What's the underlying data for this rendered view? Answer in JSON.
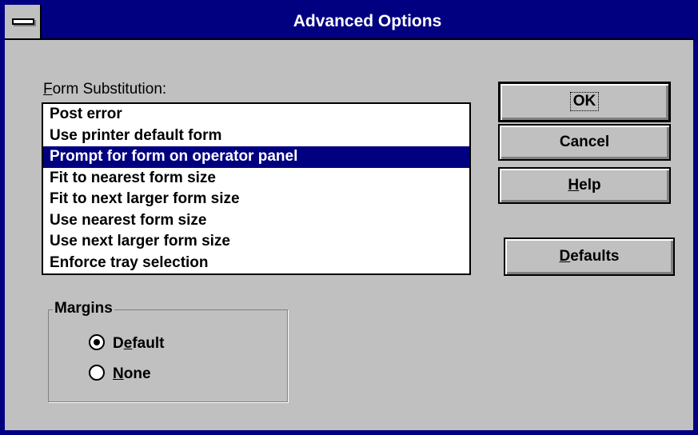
{
  "window": {
    "title": "Advanced Options"
  },
  "form_substitution": {
    "label_accel": "F",
    "label_rest": "orm Substitution:",
    "items": [
      "Post error",
      "Use printer default form",
      "Prompt for form on operator panel",
      "Fit to nearest form size",
      "Fit to next larger form size",
      "Use nearest form size",
      "Use next larger form size",
      "Enforce tray selection"
    ],
    "selected": "Prompt for form on operator panel"
  },
  "buttons": {
    "ok": "OK",
    "cancel": "Cancel",
    "help_accel": "H",
    "help_rest": "elp",
    "defaults_accel": "D",
    "defaults_rest": "efaults"
  },
  "margins": {
    "label": "Margins",
    "default_pre": "D",
    "default_accel": "e",
    "default_rest": "fault",
    "none_accel": "N",
    "none_rest": "one",
    "selected": "Default"
  },
  "colors": {
    "title_bar": "#000080",
    "face": "#c0c0c0",
    "selection": "#000080"
  }
}
